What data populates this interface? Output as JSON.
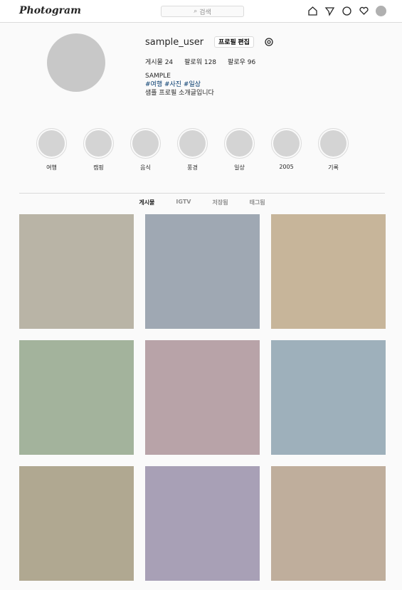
{
  "header": {
    "logo": "Photogram",
    "search_placeholder": "검색"
  },
  "profile": {
    "username": "sample_user",
    "edit_label": "프로필 편집",
    "stats": [
      "게시물 24",
      "팔로워 128",
      "팔로우 96"
    ],
    "bio": [
      "SAMPLE",
      "#여행 #사진 #일상",
      "샘플 프로필 소개글입니다"
    ]
  },
  "stories": [
    "여행",
    "캠핑",
    "음식",
    "풍경",
    "일상",
    "2005",
    "기록"
  ],
  "tabs": [
    "게시물",
    "IGTV",
    "저장됨",
    "태그됨"
  ],
  "colors": {
    "tile_tones": [
      "#b9b4a6",
      "#9fa8b3",
      "#c7b59a",
      "#a3b39c",
      "#b8a3a8",
      "#9eb0bb",
      "#b0a891",
      "#a8a0b6",
      "#bfae9c"
    ]
  }
}
